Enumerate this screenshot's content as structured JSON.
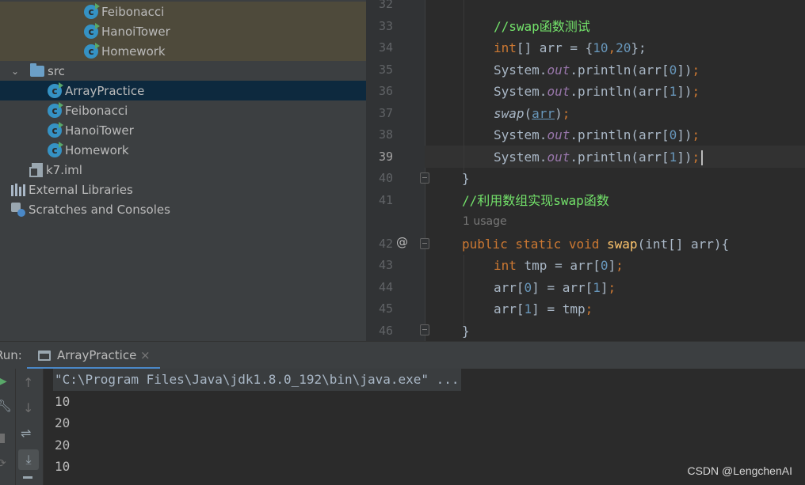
{
  "project_tree": {
    "items": [
      {
        "label": "Feibonacci",
        "icon": "java-class-run-icon"
      },
      {
        "label": "HanoiTower",
        "icon": "java-class-run-icon"
      },
      {
        "label": "Homework",
        "icon": "java-class-run-icon"
      },
      {
        "label": "src",
        "icon": "folder-icon"
      },
      {
        "label": "ArrayPractice",
        "icon": "java-class-run-icon"
      },
      {
        "label": "Feibonacci",
        "icon": "java-class-run-icon"
      },
      {
        "label": "HanoiTower",
        "icon": "java-class-run-icon"
      },
      {
        "label": "Homework",
        "icon": "java-class-run-icon"
      },
      {
        "label": "k7.iml",
        "icon": "module-file-icon"
      },
      {
        "label": "External Libraries",
        "icon": "library-icon"
      },
      {
        "label": "Scratches and Consoles",
        "icon": "scratches-icon"
      }
    ]
  },
  "editor": {
    "line_numbers": [
      "32",
      "33",
      "34",
      "35",
      "36",
      "37",
      "38",
      "39",
      "40",
      "41",
      "42",
      "43",
      "44",
      "45",
      "46"
    ],
    "current_line": "39",
    "usage_hint": "1 usage",
    "gutter_annotation": "@",
    "code": {
      "l33_comment": "//swap函数测试",
      "l34_type": "int",
      "l34_rest1": "[] arr = {",
      "l34_n1": "10",
      "l34_comma": ",",
      "l34_n2": "20",
      "l34_end": "};",
      "sys": "System.",
      "out": "out",
      "println": ".println(arr[",
      "idx0": "0",
      "idx1": "1",
      "close": "])",
      "semi": ";",
      "swap_call": "swap",
      "paren_open": "(",
      "arr_arg": "arr",
      "paren_close": ")",
      "brace_close": "}",
      "l41_comment": "//利用数组实现swap函数",
      "l42_public": "public static void ",
      "l42_name": "swap",
      "l42_rest": "(int[] arr){",
      "l43_int": "int ",
      "l43_rest": "tmp = arr[",
      "l43_idx": "0",
      "l43_end": "]",
      "l44_a": "arr[",
      "l44_b": "] = arr[",
      "l44_end": "]",
      "l45_a": "arr[",
      "l45_b": "] = tmp"
    }
  },
  "run_panel": {
    "label": "Run:",
    "tab_label": "ArrayPractice",
    "tab_close": "×",
    "command_line": "\"C:\\Program Files\\Java\\jdk1.8.0_192\\bin\\java.exe\" ...",
    "output": [
      "10",
      "20",
      "20",
      "10"
    ]
  },
  "watermark": "CSDN @LengchenAI",
  "colors": {
    "keyword": "#cc7832",
    "number": "#6897bb",
    "comment": "#73e26a",
    "field": "#9876aa",
    "function": "#ffc66d",
    "selection": "#0d293e"
  }
}
